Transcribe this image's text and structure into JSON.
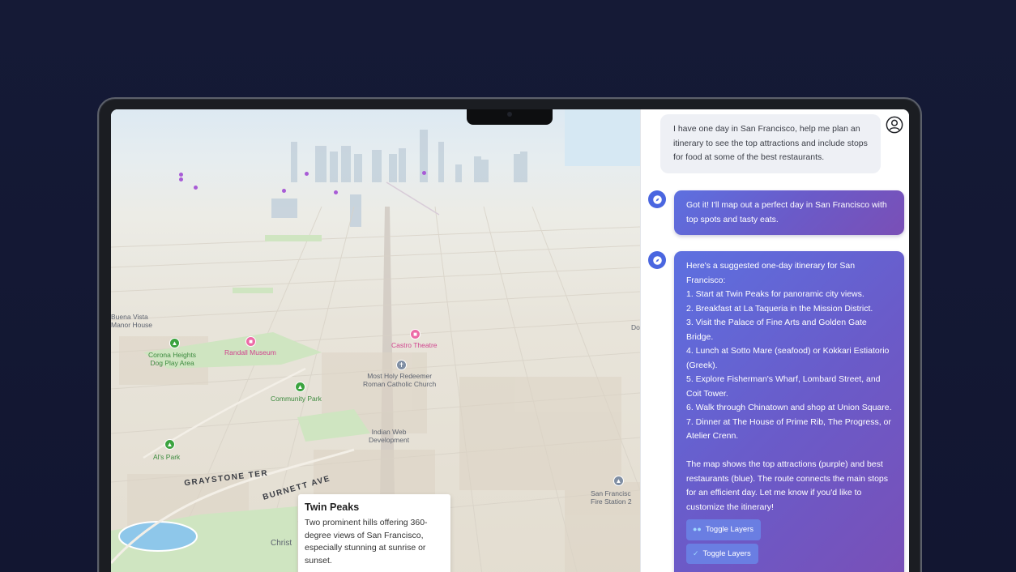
{
  "map": {
    "poi": [
      {
        "name": "poi-buena-vista",
        "label": "Buena Vista\nManor House",
        "style": ""
      },
      {
        "name": "poi-corona-heights",
        "label": "Corona Heights\nDog Play Area",
        "style": "green",
        "icon": "tree-icon"
      },
      {
        "name": "poi-randall-museum",
        "label": "Randall Museum",
        "style": "pink",
        "icon": "museum-icon"
      },
      {
        "name": "poi-castro-theatre",
        "label": "Castro Theatre",
        "style": "pink",
        "icon": "theatre-icon"
      },
      {
        "name": "poi-most-holy-redeemer",
        "label": "Most Holy Redeemer\nRoman Catholic Church",
        "style": "",
        "icon": "church-icon"
      },
      {
        "name": "poi-community-park",
        "label": "Community Park",
        "style": "green",
        "icon": "tree-icon"
      },
      {
        "name": "poi-indian-web",
        "label": "Indian Web\nDevelopment",
        "style": ""
      },
      {
        "name": "poi-als-park",
        "label": "Al's Park",
        "style": "green",
        "icon": "tree-icon"
      },
      {
        "name": "poi-sf-fire-station",
        "label": "San Francisc\nFire Station 2",
        "style": "",
        "icon": "fire-station-icon"
      },
      {
        "name": "poi-do",
        "label": "Do",
        "style": ""
      },
      {
        "name": "poi-christ",
        "label": "Christ",
        "style": ""
      }
    ],
    "streets": {
      "graystone": "GRAYSTONE TER",
      "burnett": "BURNETT AVE"
    },
    "popup": {
      "title": "Twin Peaks",
      "description": "Two prominent hills offering 360-degree views of San Francisco, especially stunning at sunrise or sunset."
    },
    "colors": {
      "attraction": "#a85bd6",
      "park": "#3ba33f",
      "restaurant": "#4a66e0"
    }
  },
  "chat": {
    "user_message": "I have one day in San Francisco, help me plan an itinerary to see the top attractions and include stops for food at some of the best restaurants.",
    "bot_reply_1": "Got it! I'll map out a perfect day in San Francisco with top spots and tasty eats.",
    "bot_reply_2": {
      "intro": "Here's a suggested one-day itinerary for San Francisco:",
      "steps": [
        "1. Start at Twin Peaks for panoramic city views.",
        "2. Breakfast at La Taqueria in the Mission District.",
        "3. Visit the Palace of Fine Arts and Golden Gate Bridge.",
        "4. Lunch at Sotto Mare (seafood) or Kokkari Estiatorio (Greek).",
        "5. Explore Fisherman's Wharf, Lombard Street, and Coit Tower.",
        "6. Walk through Chinatown and shop at Union Square.",
        "7. Dinner at The House of Prime Rib, The Progress, or Atelier Crenn."
      ],
      "outro": "The map shows the top attractions (purple) and best restaurants (blue). The route connects the main stops for an efficient day. Let me know if you'd like to customize the itinerary!",
      "buttons": [
        "Toggle Layers",
        "Toggle Layers"
      ]
    }
  }
}
